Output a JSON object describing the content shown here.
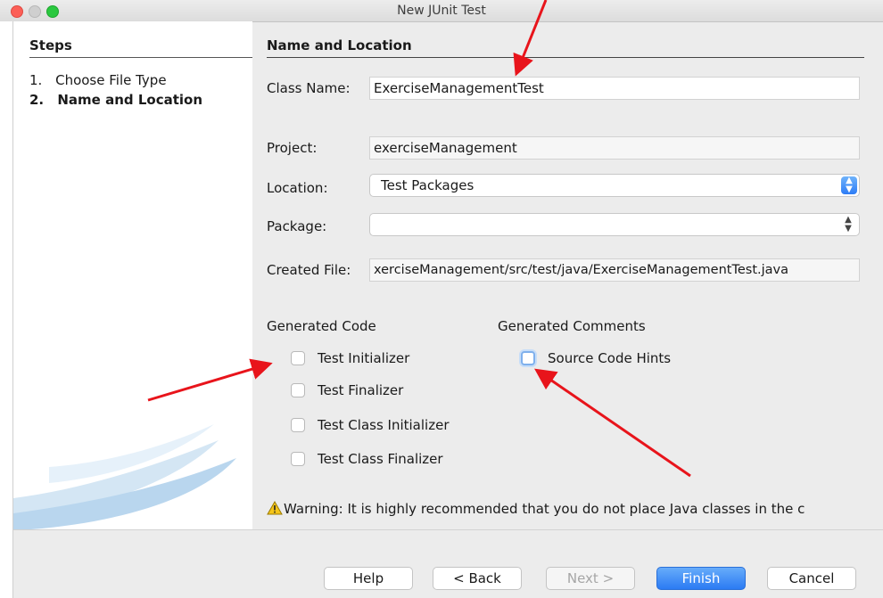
{
  "window": {
    "title": "New JUnit Test"
  },
  "steps": {
    "title": "Steps",
    "items": [
      {
        "num": "1.",
        "label": "Choose File Type"
      },
      {
        "num": "2.",
        "label": "Name and Location"
      }
    ]
  },
  "main": {
    "title": "Name and Location",
    "class_name": {
      "label": "Class Name:",
      "value": "ExerciseManagementTest"
    },
    "project": {
      "label": "Project:",
      "value": "exerciseManagement"
    },
    "location": {
      "label": "Location:",
      "value": "Test Packages"
    },
    "package": {
      "label": "Package:",
      "value": ""
    },
    "created_file": {
      "label": "Created File:",
      "value": "xerciseManagement/src/test/java/ExerciseManagementTest.java"
    },
    "generated_code": {
      "title": "Generated Code",
      "options": [
        {
          "label": "Test Initializer",
          "checked": false
        },
        {
          "label": "Test Finalizer",
          "checked": false
        },
        {
          "label": "Test Class Initializer",
          "checked": false
        },
        {
          "label": "Test Class Finalizer",
          "checked": false
        }
      ]
    },
    "generated_comments": {
      "title": "Generated Comments",
      "options": [
        {
          "label": "Source Code Hints",
          "checked": false
        }
      ]
    },
    "warning": "Warning: It is highly recommended that you do not place Java classes in the c"
  },
  "buttons": {
    "help": "Help",
    "back": "< Back",
    "next": "Next >",
    "finish": "Finish",
    "cancel": "Cancel"
  },
  "colors": {
    "annotation_arrow": "#e8141b",
    "primary_button": "#2b7bf3"
  }
}
